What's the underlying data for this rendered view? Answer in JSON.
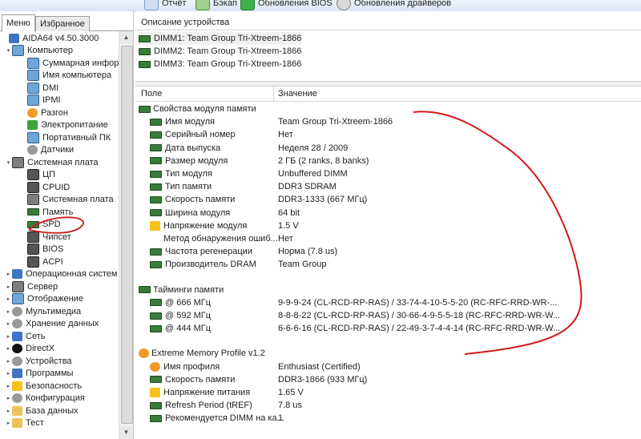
{
  "toolbar": {
    "items": [
      {
        "label": "Отчёт",
        "icon": "report-icon"
      },
      {
        "label": "Бэкап",
        "icon": "backup-icon"
      },
      {
        "label": "Обновления BIOS",
        "icon": "bios-update-icon"
      },
      {
        "label": "Обновления драйверов",
        "icon": "driver-update-icon"
      }
    ]
  },
  "left": {
    "tabs": [
      "Меню",
      "Избранное"
    ],
    "tree": [
      {
        "label": "AIDA64 v4.50.3000",
        "icon": "aida64-logo-icon",
        "level": 0,
        "expander": ""
      },
      {
        "label": "Компьютер",
        "icon": "computer-icon",
        "level": 1,
        "expander": "▾"
      },
      {
        "label": "Суммарная инфор",
        "icon": "computer-icon",
        "level": 2,
        "expander": ""
      },
      {
        "label": "Имя компьютера",
        "icon": "computer-icon",
        "level": 2,
        "expander": ""
      },
      {
        "label": "DMI",
        "icon": "dmi-icon",
        "level": 2,
        "expander": ""
      },
      {
        "label": "IPMI",
        "icon": "ipmi-icon",
        "level": 2,
        "expander": ""
      },
      {
        "label": "Разгон",
        "icon": "overclock-icon",
        "level": 2,
        "expander": ""
      },
      {
        "label": "Электропитание",
        "icon": "power-icon",
        "level": 2,
        "expander": ""
      },
      {
        "label": "Портативный ПК",
        "icon": "laptop-icon",
        "level": 2,
        "expander": ""
      },
      {
        "label": "Датчики",
        "icon": "sensor-icon",
        "level": 2,
        "expander": ""
      },
      {
        "label": "Системная плата",
        "icon": "motherboard-icon",
        "level": 1,
        "expander": "▾"
      },
      {
        "label": "ЦП",
        "icon": "cpu-icon",
        "level": 2,
        "expander": ""
      },
      {
        "label": "CPUID",
        "icon": "cpu-icon",
        "level": 2,
        "expander": ""
      },
      {
        "label": "Системная плата",
        "icon": "motherboard-icon",
        "level": 2,
        "expander": ""
      },
      {
        "label": "Память",
        "icon": "memory-icon",
        "level": 2,
        "expander": ""
      },
      {
        "label": "SPD",
        "icon": "memory-icon",
        "level": 2,
        "expander": ""
      },
      {
        "label": "Чипсет",
        "icon": "chipset-icon",
        "level": 2,
        "expander": ""
      },
      {
        "label": "BIOS",
        "icon": "bios-icon",
        "level": 2,
        "expander": ""
      },
      {
        "label": "ACPI",
        "icon": "acpi-icon",
        "level": 2,
        "expander": ""
      },
      {
        "label": "Операционная систем",
        "icon": "windows-icon",
        "level": 1,
        "expander": "▸"
      },
      {
        "label": "Сервер",
        "icon": "server-icon",
        "level": 1,
        "expander": "▸"
      },
      {
        "label": "Отображение",
        "icon": "display-icon",
        "level": 1,
        "expander": "▸"
      },
      {
        "label": "Мультимедиа",
        "icon": "multimedia-icon",
        "level": 1,
        "expander": "▸"
      },
      {
        "label": "Хранение данных",
        "icon": "storage-icon",
        "level": 1,
        "expander": "▸"
      },
      {
        "label": "Сеть",
        "icon": "network-icon",
        "level": 1,
        "expander": "▸"
      },
      {
        "label": "DirectX",
        "icon": "directx-icon",
        "level": 1,
        "expander": "▸"
      },
      {
        "label": "Устройства",
        "icon": "devices-icon",
        "level": 1,
        "expander": "▸"
      },
      {
        "label": "Программы",
        "icon": "programs-icon",
        "level": 1,
        "expander": "▸"
      },
      {
        "label": "Безопасность",
        "icon": "security-icon",
        "level": 1,
        "expander": "▸"
      },
      {
        "label": "Конфигурация",
        "icon": "config-icon",
        "level": 1,
        "expander": "▸"
      },
      {
        "label": "База данных",
        "icon": "database-icon",
        "level": 1,
        "expander": "▸"
      },
      {
        "label": "Тест",
        "icon": "benchmark-icon",
        "level": 1,
        "expander": "▸"
      }
    ]
  },
  "devices": {
    "header": "Описание устройства",
    "items": [
      "DIMM1: Team Group Tri-Xtreem-1866",
      "DIMM2: Team Group Tri-Xtreem-1866",
      "DIMM3: Team Group Tri-Xtreem-1866"
    ]
  },
  "details": {
    "col_field": "Поле",
    "col_value": "Значение",
    "groups": [
      {
        "title": "Свойства модуля памяти",
        "icon": "memory-icon",
        "rows": [
          {
            "field": "Имя модуля",
            "value": "Team Group Tri-Xtreem-1866",
            "icon": "memory-icon"
          },
          {
            "field": "Серийный номер",
            "value": "Нет",
            "icon": "memory-icon"
          },
          {
            "field": "Дата выпуска",
            "value": "Неделя 28 / 2009",
            "icon": "memory-icon"
          },
          {
            "field": "Размер модуля",
            "value": "2 ГБ (2 ranks, 8 banks)",
            "icon": "memory-icon"
          },
          {
            "field": "Тип модуля",
            "value": "Unbuffered DIMM",
            "icon": "memory-icon"
          },
          {
            "field": "Тип памяти",
            "value": "DDR3 SDRAM",
            "icon": "memory-icon"
          },
          {
            "field": "Скорость памяти",
            "value": "DDR3-1333 (667 МГц)",
            "icon": "memory-icon"
          },
          {
            "field": "Ширина модуля",
            "value": "64 bit",
            "icon": "memory-icon"
          },
          {
            "field": "Напряжение модуля",
            "value": "1.5 V",
            "icon": "warning-icon"
          },
          {
            "field": "Метод обнаружения ошиб...",
            "value": "Нет",
            "icon": ""
          },
          {
            "field": "Частота регенерации",
            "value": "Норма (7.8 us)",
            "icon": "memory-icon"
          },
          {
            "field": "Производитель DRAM",
            "value": "Team Group",
            "icon": "memory-icon"
          }
        ]
      },
      {
        "title": "Тайминги памяти",
        "icon": "memory-icon",
        "rows": [
          {
            "field": "@ 666 МГц",
            "value": "9-9-9-24  (CL-RCD-RP-RAS) / 33-74-4-10-5-5-20  (RC-RFC-RRD-WR-...",
            "icon": "memory-icon"
          },
          {
            "field": "@ 592 МГц",
            "value": "8-8-8-22  (CL-RCD-RP-RAS) / 30-66-4-9-5-5-18  (RC-RFC-RRD-WR-W...",
            "icon": "memory-icon"
          },
          {
            "field": "@ 444 МГц",
            "value": "6-6-6-16  (CL-RCD-RP-RAS) / 22-49-3-7-4-4-14  (RC-RFC-RRD-WR-W...",
            "icon": "memory-icon"
          }
        ]
      },
      {
        "title": "Extreme Memory Profile v1.2",
        "icon": "flame-icon",
        "rows": [
          {
            "field": "Имя профиля",
            "value": "Enthusiast (Certified)",
            "icon": "flame-icon"
          },
          {
            "field": "Скорость памяти",
            "value": "DDR3-1866 (933 МГц)",
            "icon": "memory-icon"
          },
          {
            "field": "Напряжение питания",
            "value": "1.65 V",
            "icon": "warning-icon"
          },
          {
            "field": "Refresh Period (tREF)",
            "value": "7.8 us",
            "icon": "memory-icon"
          },
          {
            "field": "Рекомендуется DIMM на ка...",
            "value": "1",
            "icon": "memory-icon"
          }
        ]
      }
    ]
  }
}
